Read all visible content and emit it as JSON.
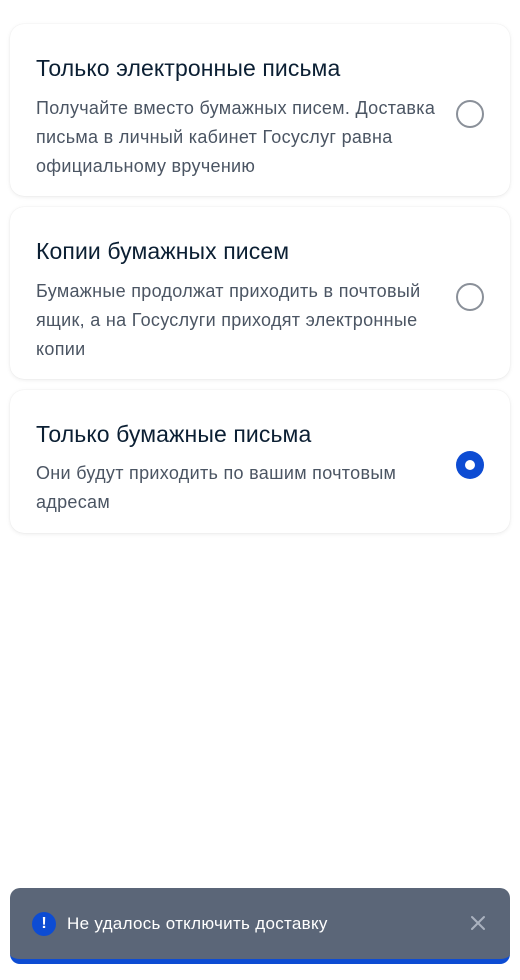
{
  "options": [
    {
      "title": "Только электронные письма",
      "description": "Получайте вместо бумажных писем. Доставка письма в личный кабинет Госуслуг равна официальному вручению",
      "selected": false
    },
    {
      "title": "Копии бумажных писем",
      "description": "Бумажные продолжат приходить в почтовый ящик, а на Госуслуги приходят электронные копии",
      "selected": false
    },
    {
      "title": "Только бумажные письма",
      "description": "Они будут приходить по вашим почтовым адресам",
      "selected": true
    }
  ],
  "toast": {
    "icon": "alert-icon",
    "icon_glyph": "!",
    "message": "Не удалось отключить доставку",
    "close_icon": "close-icon"
  },
  "colors": {
    "accent": "#0d4cd3",
    "toast_background": "#5b6678",
    "title_text": "#0b1f33",
    "description_text": "#4b5563",
    "radio_border": "#8a9099"
  }
}
